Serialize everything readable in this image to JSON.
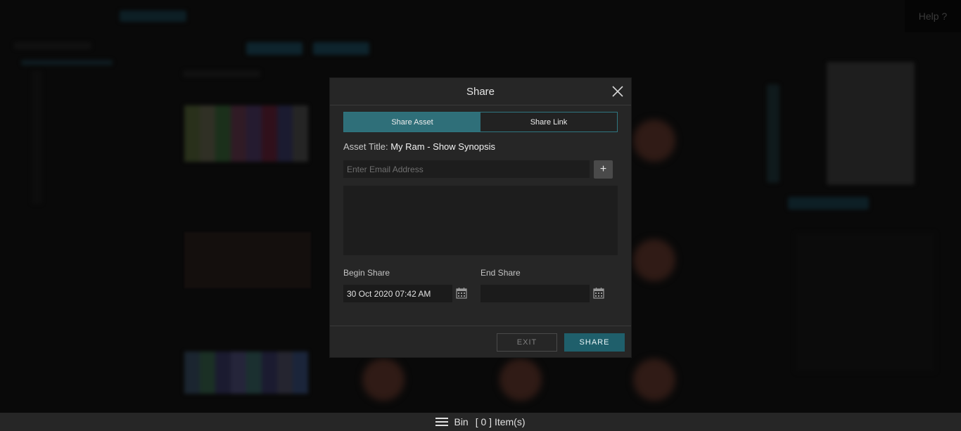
{
  "help": {
    "label": "Help ?"
  },
  "modal": {
    "title": "Share",
    "tabs": [
      {
        "label": "Share Asset",
        "active": true
      },
      {
        "label": "Share Link",
        "active": false
      }
    ],
    "asset_title_label": "Asset Title:",
    "asset_title_value": "My Ram - Show Synopsis",
    "email_placeholder": "Enter Email Address",
    "add_label": "+",
    "begin_share_label": "Begin Share",
    "begin_share_value": "30 Oct 2020 07:42 AM",
    "end_share_label": "End Share",
    "end_share_value": "",
    "exit_label": "EXIT",
    "share_label": "SHARE"
  },
  "bin": {
    "label": "Bin",
    "count_text": "[ 0 ] Item(s)"
  },
  "colors": {
    "accent": "#2f6f79",
    "share_button": "#1f5f6b",
    "background": "#0e0e0e",
    "modal": "#262626"
  },
  "icons": [
    "close-icon",
    "plus-icon",
    "calendar-icon",
    "menu-icon"
  ]
}
